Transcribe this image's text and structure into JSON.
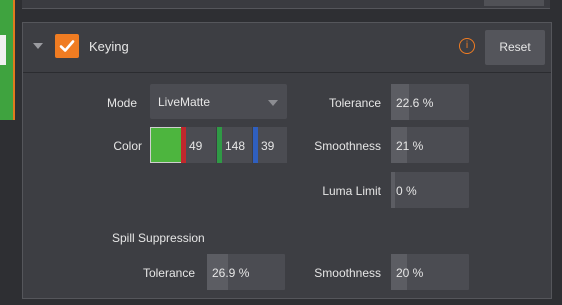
{
  "panel": {
    "title": "Keying",
    "enabled": true,
    "reset_label": "Reset",
    "info_icon": "info-icon",
    "check_icon": "checkmark-icon"
  },
  "mode": {
    "label": "Mode",
    "value": "LiveMatte"
  },
  "color": {
    "label": "Color",
    "swatch": "#4db53e",
    "r": "49",
    "g": "148",
    "b": "39"
  },
  "tolerance": {
    "label": "Tolerance",
    "value": "22.6 %",
    "level": 0.226
  },
  "smoothness": {
    "label": "Smoothness",
    "value": "21 %",
    "level": 0.21
  },
  "luma_limit": {
    "label": "Luma Limit",
    "value": "0 %",
    "level": 0.0
  },
  "spill": {
    "heading": "Spill Suppression",
    "tolerance": {
      "label": "Tolerance",
      "value": "26.9 %",
      "level": 0.269
    },
    "smoothness": {
      "label": "Smoothness",
      "value": "20 %",
      "level": 0.2
    }
  },
  "colors": {
    "accent": "#f07c22",
    "red_channel": "#c0282d",
    "green_channel": "#2f9a45",
    "blue_channel": "#2f5fbf"
  }
}
